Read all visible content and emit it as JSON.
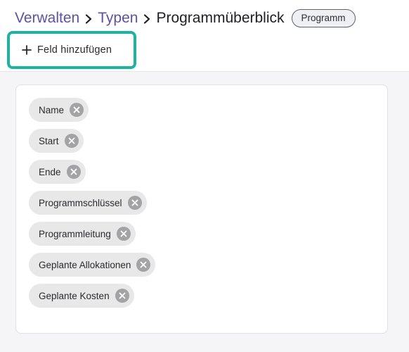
{
  "breadcrumb": {
    "items": [
      "Verwalten",
      "Typen"
    ],
    "current": "Programmüberblick",
    "badge": "Programm"
  },
  "toolbar": {
    "add_field_label": "Feld hinzufügen",
    "add_field_icon": "plus-icon",
    "focus_ring_color": "#1bb4a2"
  },
  "fields": [
    {
      "label": "Name"
    },
    {
      "label": "Start"
    },
    {
      "label": "Ende"
    },
    {
      "label": "Programmschlüssel"
    },
    {
      "label": "Programmleitung"
    },
    {
      "label": "Geplante Allokationen"
    },
    {
      "label": "Geplante Kosten"
    }
  ],
  "colors": {
    "link": "#5b4fbd",
    "chip_bg": "#e8e8e8",
    "chip_remove_bg": "#a3a3a6"
  }
}
